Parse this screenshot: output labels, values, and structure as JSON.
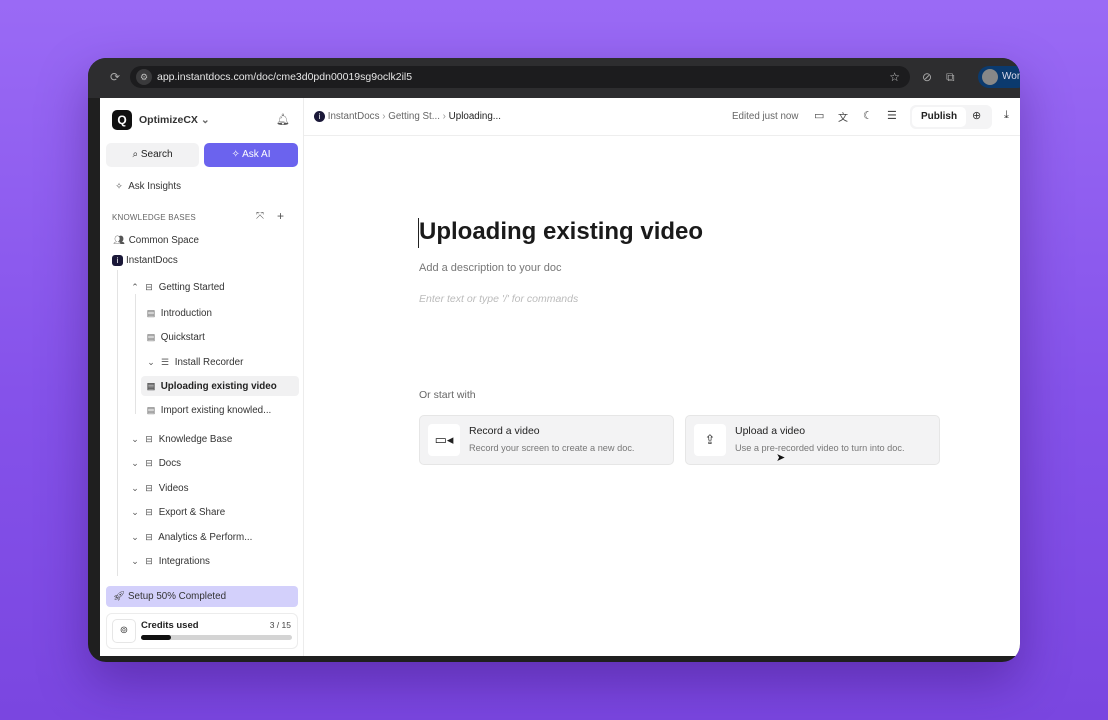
{
  "browser": {
    "url": "app.instantdocs.com/doc/cme3d0pdn00019sg9oclk2il5",
    "profile_label": "Wor"
  },
  "sidebar": {
    "workspace": "OptimizeCX",
    "search_label": "Search",
    "ask_ai_label": "Ask AI",
    "ask_insights": "Ask Insights",
    "section_title": "KNOWLEDGE BASES",
    "common_space": "Common Space",
    "kb_name": "InstantDocs",
    "tree": [
      {
        "label": "Getting Started"
      },
      {
        "label": "Introduction"
      },
      {
        "label": "Quickstart"
      },
      {
        "label": "Install Recorder"
      },
      {
        "label": "Uploading existing video",
        "selected": true
      },
      {
        "label": "Import existing knowled..."
      },
      {
        "label": "Knowledge Base"
      },
      {
        "label": "Docs"
      },
      {
        "label": "Videos"
      },
      {
        "label": "Export & Share"
      },
      {
        "label": "Analytics & Perform..."
      },
      {
        "label": "Integrations"
      }
    ],
    "setup": {
      "label": "Setup 50% Completed",
      "percent": 50
    },
    "credits": {
      "label": "Credits used",
      "value": "3 / 15",
      "used": 3,
      "total": 15
    }
  },
  "topbar": {
    "breadcrumb": [
      "InstantDocs",
      "Getting St...",
      "Uploading..."
    ],
    "status": "Edited just now",
    "publish_label": "Publish"
  },
  "doc": {
    "title": "Uploading existing video",
    "description_placeholder": "Add a description to your doc",
    "body_placeholder": "Enter text or type '/' for commands",
    "start_with": "Or start with",
    "cards": [
      {
        "title": "Record a video",
        "desc": "Record your screen to create a new doc.",
        "icon": "video-camera-icon"
      },
      {
        "title": "Upload a video",
        "desc": "Use a pre-recorded video to turn into doc.",
        "icon": "upload-icon"
      }
    ]
  },
  "colors": {
    "accent": "#6b63ee",
    "setup_bg": "#d3d0fb",
    "background": "#8b5cf6"
  }
}
